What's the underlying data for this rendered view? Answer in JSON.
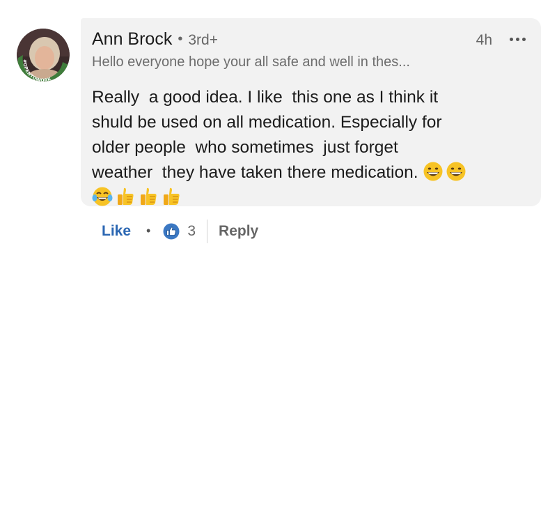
{
  "comment": {
    "author": {
      "name": "Ann Brock",
      "separator": "•",
      "degree": "3rd+",
      "headline": "Hello everyone hope your all safe and well in thes...",
      "avatar_badge": "#OPENTOWORK",
      "badge_color": "#3f7d3b"
    },
    "time": "4h",
    "more_icon": "more-horizontal-icon",
    "text": "Really  a good idea. I like  this one as I think it\nshuld be used on all medication. Especially for\nolder people  who sometimes  just forget\nweather  they have taken there medication. ",
    "emojis_inline": [
      "grinning-face-icon",
      "grinning-face-icon"
    ],
    "emojis_line": [
      "tears-of-joy-icon",
      "thumbs-up-icon",
      "thumbs-up-icon",
      "thumbs-up-icon"
    ]
  },
  "actions": {
    "like_label": "Like",
    "separator": "•",
    "reaction_icon": "like-reaction-icon",
    "reaction_count": "3",
    "reply_label": "Reply",
    "like_color": "#2a66b2"
  }
}
